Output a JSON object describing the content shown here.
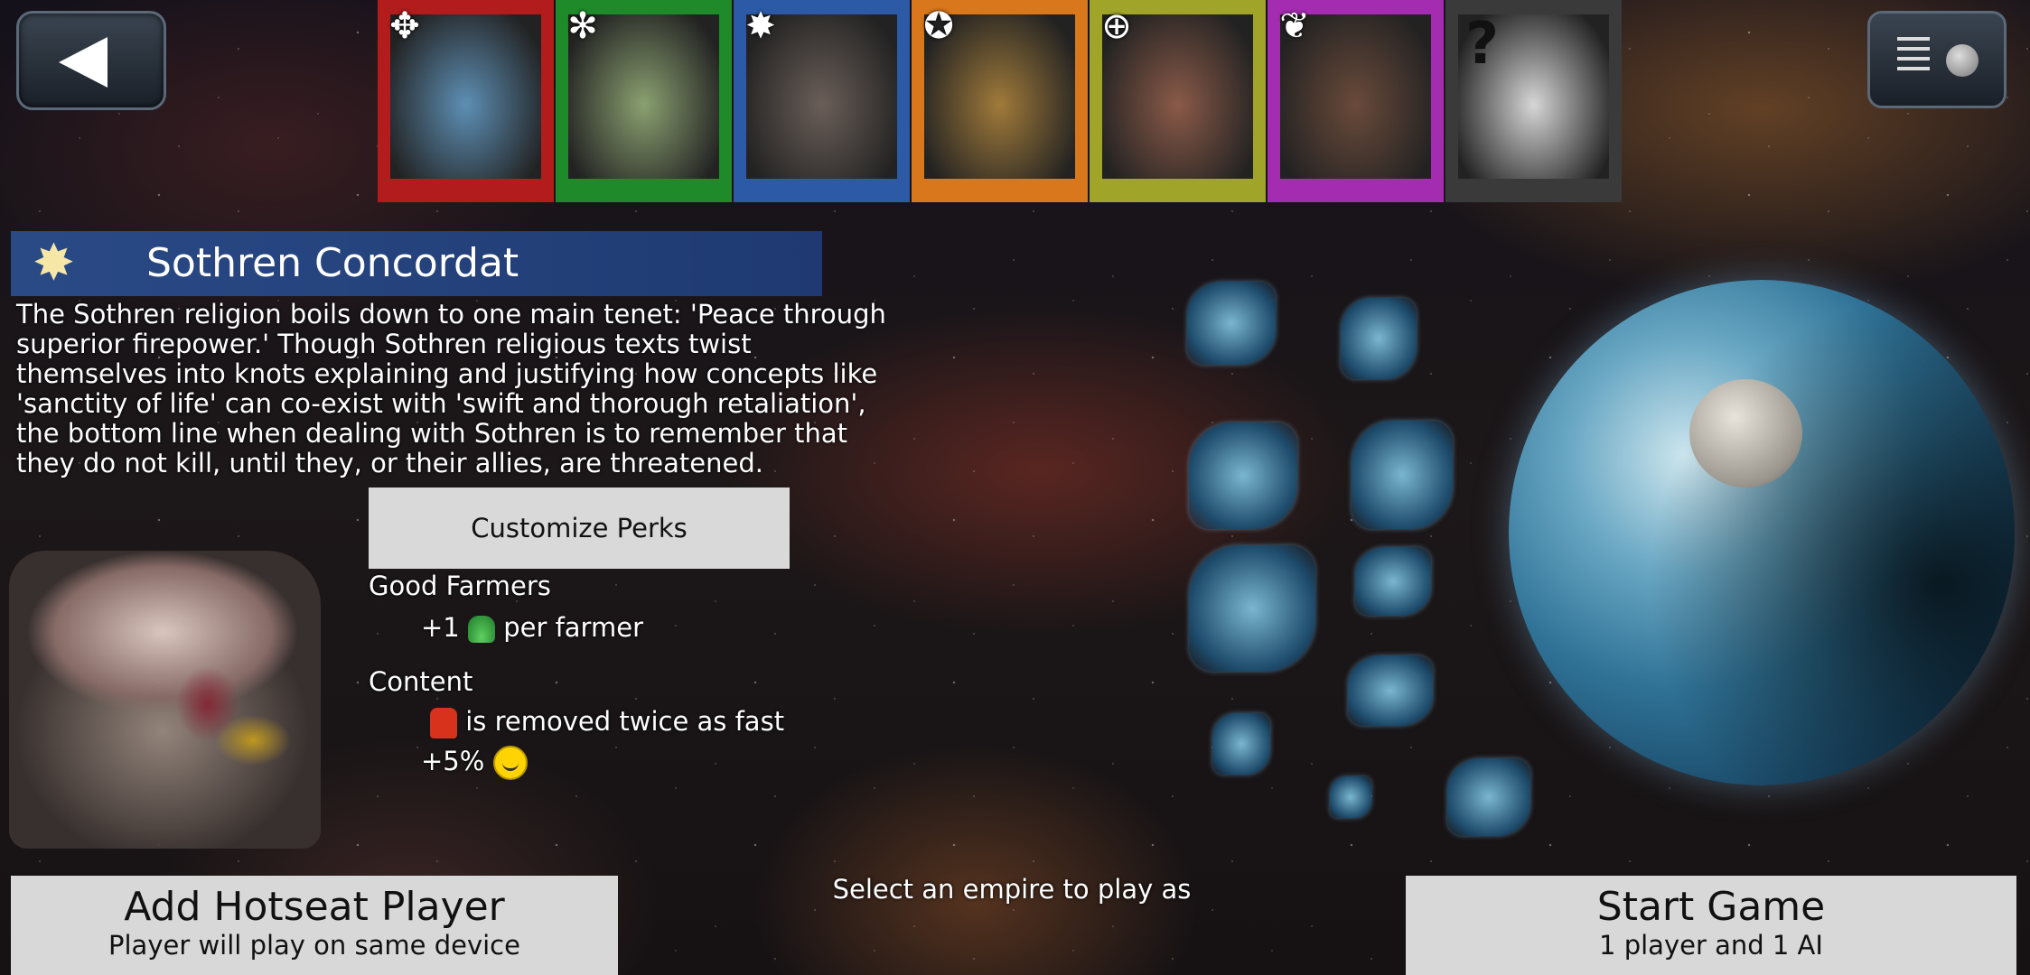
{
  "portraits": [
    {
      "emblem": "winged-emblem-icon",
      "emblem_glyph": "✥",
      "frame": "#b21c1c",
      "face_bg": "#5d8fb4"
    },
    {
      "emblem": "wreath-emblem-icon",
      "emblem_glyph": "✻",
      "frame": "#1f8a2a",
      "face_bg": "#8aa070"
    },
    {
      "emblem": "star-emblem-icon",
      "emblem_glyph": "✸",
      "frame": "#2c5aa6",
      "face_bg": "#6a5e58"
    },
    {
      "emblem": "shield-emblem-icon",
      "emblem_glyph": "✪",
      "frame": "#d8771c",
      "face_bg": "#a07a3a"
    },
    {
      "emblem": "globe-emblem-icon",
      "emblem_glyph": "⊕",
      "frame": "#a0a428",
      "face_bg": "#8a5a48"
    },
    {
      "emblem": "leaf-emblem-icon",
      "emblem_glyph": "❦",
      "frame": "#a42cb0",
      "face_bg": "#6a4a3a"
    },
    {
      "emblem": "unknown-emblem-icon",
      "emblem_glyph": "",
      "frame": "#3a3a3a",
      "face_bg": "#d6d6d6",
      "question": "?"
    }
  ],
  "empire": {
    "name": "Sothren Concordat",
    "description": "The Sothren religion boils down to one main tenet: 'Peace through superior firepower.' Though Sothren religious texts twist themselves into knots explaining and justifying how concepts like 'sanctity of life' can co-exist with 'swift and thorough retaliation', the bottom line when dealing with Sothren is to remember that they do not kill, until they, or their allies, are threatened."
  },
  "perks": {
    "button_label": "Customize Perks",
    "items": [
      {
        "title": "Good Farmers",
        "prefix": "+1",
        "suffix": "per farmer"
      },
      {
        "title": "Content",
        "line1": "is removed twice as fast",
        "line2_prefix": "+5%"
      }
    ]
  },
  "bottom": {
    "hotseat_label": "Add Hotseat Player",
    "hotseat_sub": "Player will play on same device",
    "hint": "Select an empire to play as",
    "start_label": "Start Game",
    "start_sub": "1 player and 1 AI"
  }
}
